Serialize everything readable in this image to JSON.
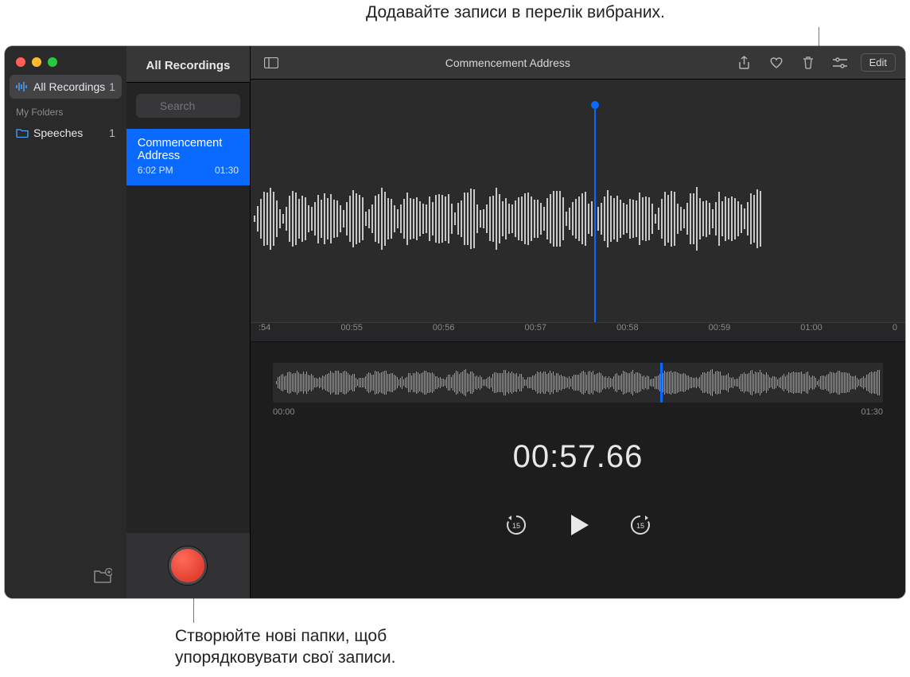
{
  "callouts": {
    "top": "Додавайте записи в перелік вибраних.",
    "bottom_line1": "Створюйте нові папки, щоб",
    "bottom_line2": "упорядковувати свої записи."
  },
  "sidebar": {
    "all_recordings_label": "All Recordings",
    "all_recordings_count": "1",
    "my_folders_header": "My Folders",
    "folders": [
      {
        "name": "Speeches",
        "count": "1"
      }
    ]
  },
  "list": {
    "header": "All Recordings",
    "search_placeholder": "Search",
    "items": [
      {
        "title": "Commencement Address",
        "time": "6:02 PM",
        "duration": "01:30"
      }
    ]
  },
  "toolbar": {
    "title": "Commencement Address",
    "edit_label": "Edit"
  },
  "waveform": {
    "ticks": [
      ":54",
      "00:55",
      "00:56",
      "00:57",
      "00:58",
      "00:59",
      "01:00",
      "0"
    ]
  },
  "overview": {
    "start": "00:00",
    "end": "01:30"
  },
  "playback": {
    "time": "00:57.66",
    "skip_seconds": "15"
  }
}
